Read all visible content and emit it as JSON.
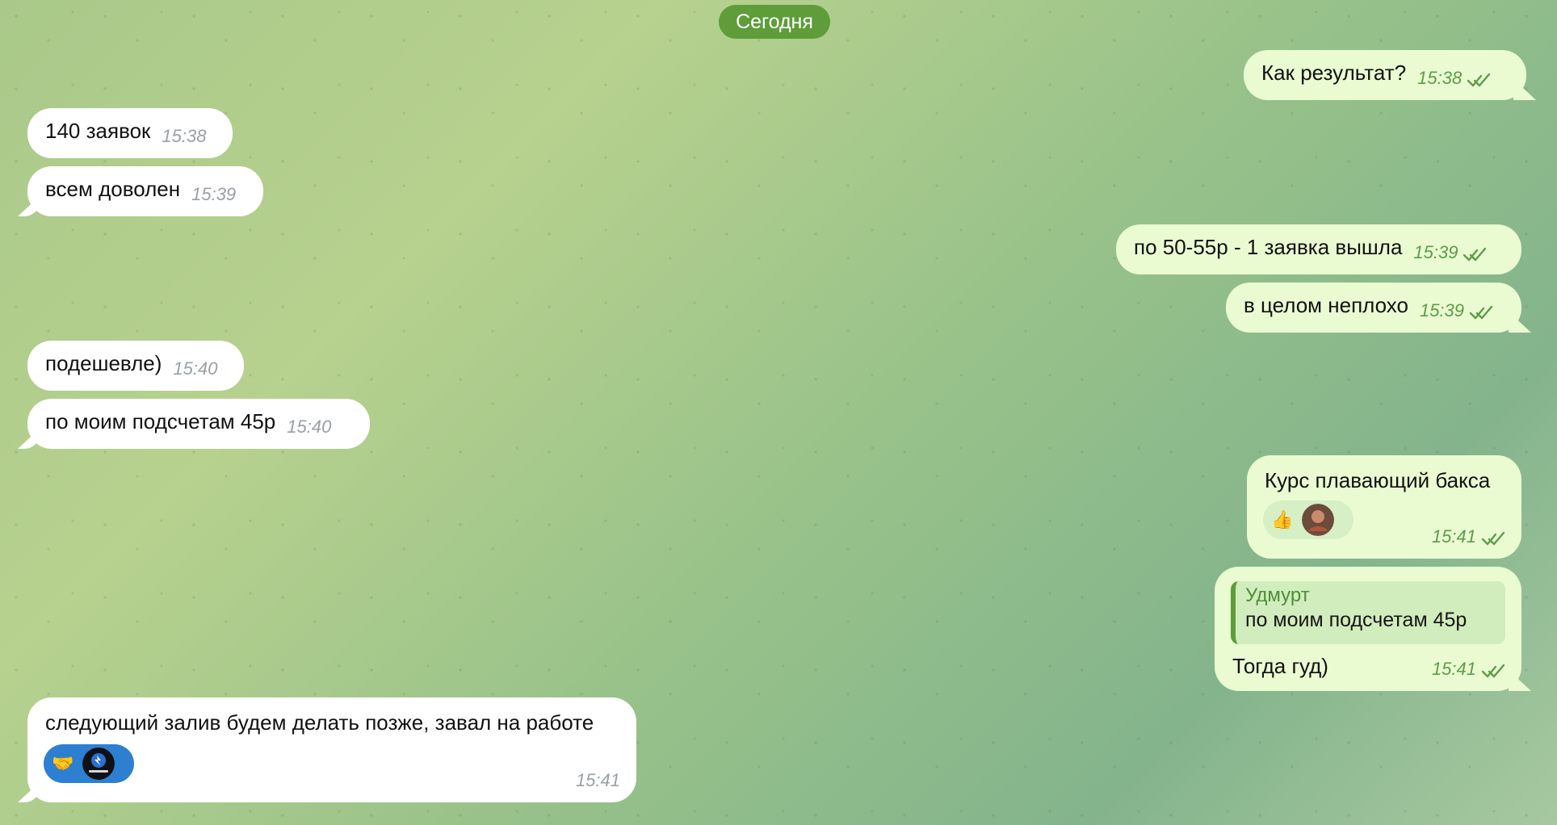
{
  "chat": {
    "date_separator": "Сегодня",
    "messages": [
      {
        "text": "Как результат?",
        "time": "15:38",
        "direction": "outgoing"
      },
      {
        "text": "140 заявок",
        "time": "15:38",
        "direction": "incoming"
      },
      {
        "text": "всем доволен",
        "time": "15:39",
        "direction": "incoming"
      },
      {
        "text": "по 50-55р - 1 заявка вышла",
        "time": "15:39",
        "direction": "outgoing"
      },
      {
        "text": "в целом неплохо",
        "time": "15:39",
        "direction": "outgoing"
      },
      {
        "text": "подешевле)",
        "time": "15:40",
        "direction": "incoming"
      },
      {
        "text": "по моим подсчетам 45р",
        "time": "15:40",
        "direction": "incoming"
      },
      {
        "text": "Курс плавающий бакса",
        "time": "15:41",
        "direction": "outgoing"
      },
      {
        "quote_author": "Удмурт",
        "quote_text": "по моим подсчетам 45р",
        "text": "Тогда гуд)",
        "time": "15:41",
        "direction": "outgoing"
      },
      {
        "text": "следующий залив будем делать позже, завал на работе",
        "time": "15:41",
        "direction": "incoming"
      }
    ],
    "reactions": {
      "outgoing_course": {
        "emoji": "👍"
      },
      "incoming_last": {
        "emoji": "🤝"
      }
    }
  },
  "colors": {
    "incoming_bubble": "#ffffff",
    "outgoing_bubble": "#eafbd1",
    "date_chip": "#5e9d3a",
    "outgoing_meta": "#5f9b4d",
    "incoming_meta": "#9aa0a6"
  }
}
